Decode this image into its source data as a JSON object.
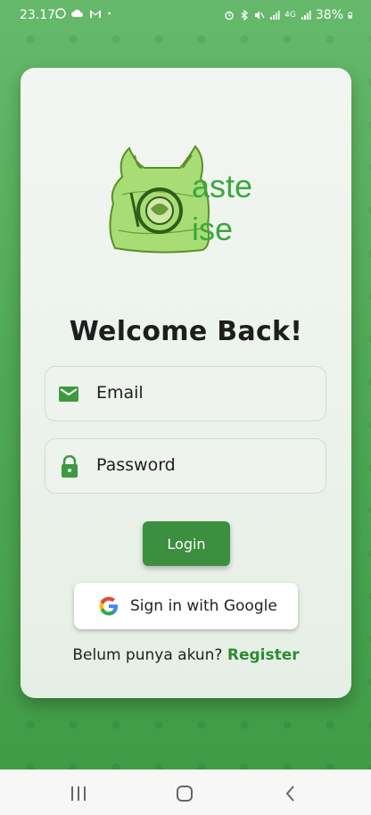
{
  "status_bar": {
    "time": "23.17",
    "network": "4G",
    "battery": "38%"
  },
  "logo": {
    "line1": "aste",
    "line2": "ise"
  },
  "login": {
    "title": "Welcome Back!",
    "email_label": "Email",
    "password_label": "Password",
    "login_button": "Login",
    "google_button": "Sign in with Google",
    "no_account_text": "Belum punya akun?",
    "register_link": "Register"
  },
  "colors": {
    "brand_green": "#3b8f3f",
    "background_green": "#4fa955",
    "icon_green": "#3c9a40"
  }
}
